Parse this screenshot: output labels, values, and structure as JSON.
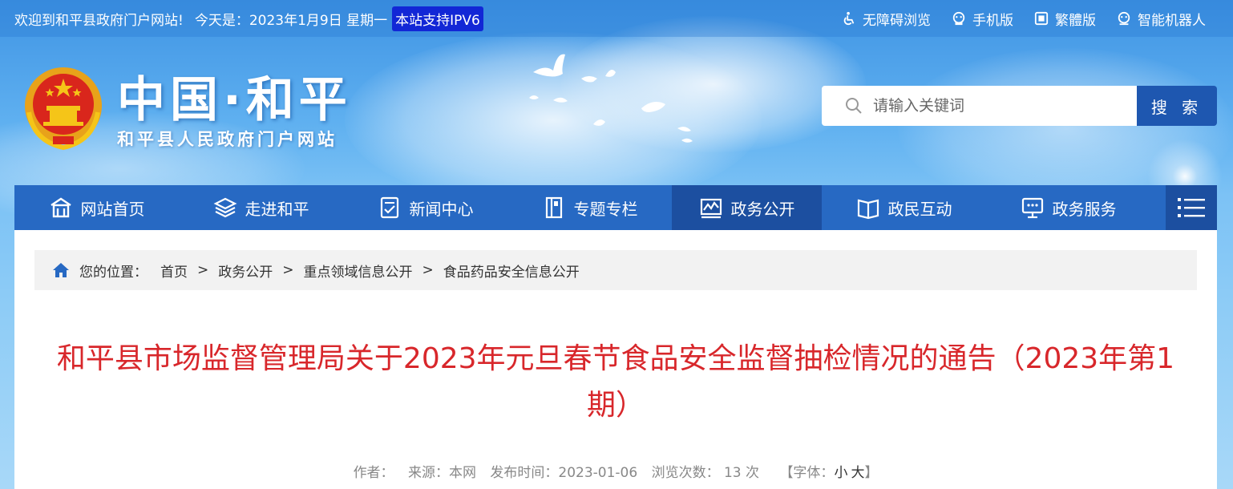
{
  "topbar": {
    "welcome": "欢迎到和平县政府门户网站!",
    "date": "今天是：2023年1月9日 星期一",
    "ipv6": "本站支持IPV6",
    "links": [
      {
        "label": "无障碍浏览",
        "icon": "accessibility-icon"
      },
      {
        "label": "手机版",
        "icon": "mobile-icon"
      },
      {
        "label": "繁體版",
        "icon": "traditional-chinese-icon"
      },
      {
        "label": "智能机器人",
        "icon": "robot-icon"
      }
    ]
  },
  "header": {
    "site_name": "中国·和平",
    "site_subtitle": "和平县人民政府门户网站"
  },
  "search": {
    "placeholder": "请输入关键词",
    "button_label": "搜 索"
  },
  "nav": {
    "items": [
      {
        "label": "网站首页",
        "icon": "home-icon"
      },
      {
        "label": "走进和平",
        "icon": "layers-icon"
      },
      {
        "label": "新闻中心",
        "icon": "news-icon"
      },
      {
        "label": "专题专栏",
        "icon": "column-icon"
      },
      {
        "label": "政务公开",
        "icon": "chart-icon",
        "active": true
      },
      {
        "label": "政民互动",
        "icon": "book-icon"
      },
      {
        "label": "政务服务",
        "icon": "monitor-icon"
      }
    ],
    "menu_icon": "menu-icon"
  },
  "breadcrumb": {
    "label": "您的位置：",
    "items": [
      "首页",
      "政务公开",
      "重点领域信息公开",
      "食品药品安全信息公开"
    ],
    "separator": ">"
  },
  "article": {
    "title": "和平县市场监督管理局关于2023年元旦春节食品安全监督抽检情况的通告（2023年第1期）",
    "meta": {
      "author_label": "作者：",
      "source_label": "来源：",
      "source": "本网",
      "date_label": "发布时间：",
      "date": "2023-01-06",
      "views_label": "浏览次数：",
      "views": "13",
      "views_unit": "次",
      "font_label": "【字体：",
      "font_small": "小",
      "font_large": "大",
      "font_close": "】"
    }
  },
  "colors": {
    "nav_bg": "#2769c3",
    "nav_active": "#1c4fa0",
    "title_red": "#d8272b",
    "search_button": "#1e57b0",
    "ipv6_bg": "#1227d6"
  }
}
